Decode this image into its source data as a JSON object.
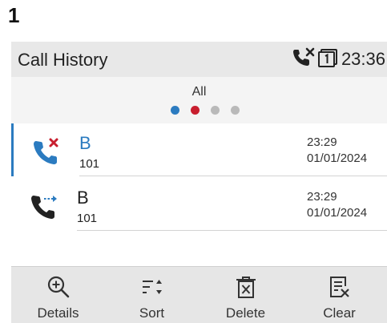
{
  "step": {
    "number": "1"
  },
  "statusbar": {
    "title": "Call History",
    "clock": "23:36",
    "icons": [
      "missed-call-icon",
      "line-one-icon"
    ]
  },
  "filter": {
    "label": "All",
    "page_count": 4,
    "active_page": 1,
    "dot_colors": [
      "#2b7bc0",
      "#c81e2e",
      "#b9b9b9",
      "#b9b9b9"
    ]
  },
  "calls": [
    {
      "type": "missed",
      "icon": "missed-call-icon",
      "name": "B",
      "name_color": "#2b7bc0",
      "number": "101",
      "time": "23:29",
      "date": "01/01/2024",
      "selected": true
    },
    {
      "type": "forwarded",
      "icon": "forwarded-call-icon",
      "name": "B",
      "name_color": "#222222",
      "number": "101",
      "time": "23:29",
      "date": "01/01/2024",
      "selected": false
    }
  ],
  "softkeys": [
    {
      "label": "Details",
      "icon": "zoom-in-icon"
    },
    {
      "label": "Sort",
      "icon": "sort-icon"
    },
    {
      "label": "Delete",
      "icon": "trash-icon"
    },
    {
      "label": "Clear",
      "icon": "clear-list-icon"
    }
  ],
  "colors": {
    "accent": "#2b7bc0",
    "missed": "#c81e2e"
  }
}
